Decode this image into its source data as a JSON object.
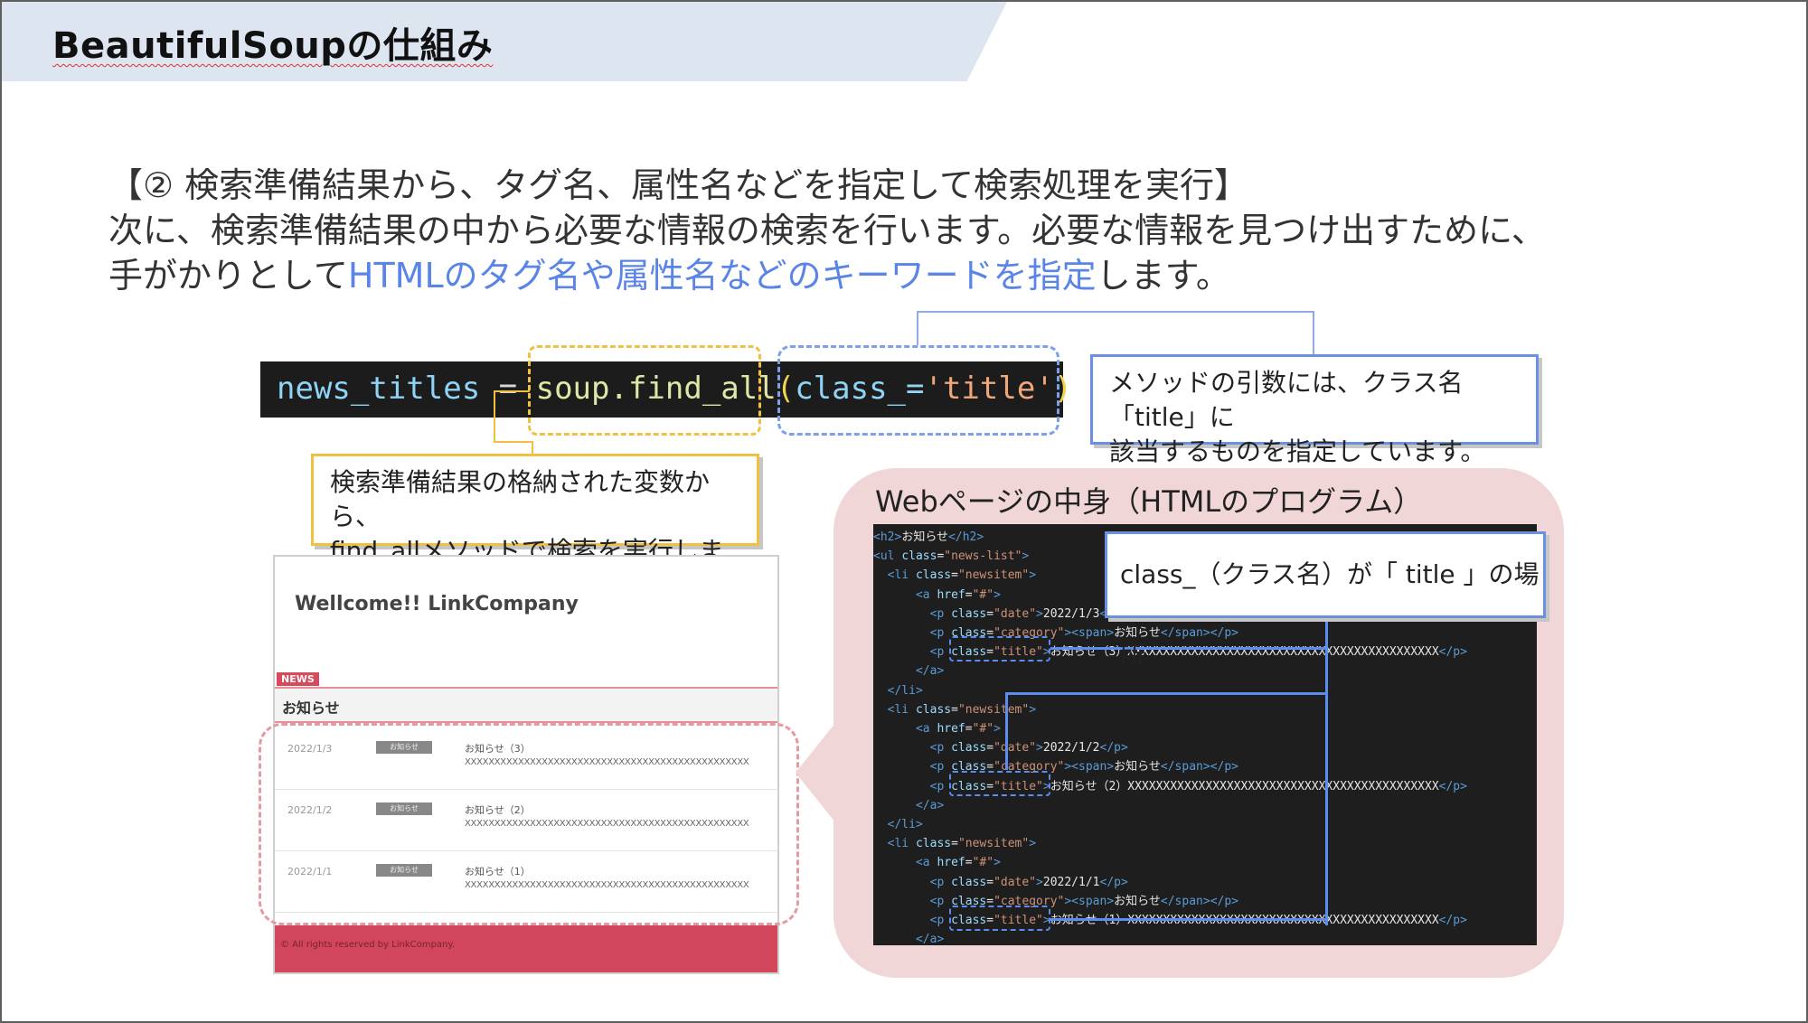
{
  "slide": {
    "title": "BeautifulSoupの仕組み",
    "intro": {
      "line1": "【② 検索準備結果から、タグ名、属性名などを指定して検索処理を実行】",
      "line2": "次に、検索準備結果の中から必要な情報の検索を行います。必要な情報を見つけ出すために、",
      "line3_pre": "手がかりとして",
      "line3_highlight": "HTMLのタグ名や属性名などのキーワードを指定",
      "line3_post": "します。"
    }
  },
  "code": {
    "var": "news_titles",
    "eq": " = ",
    "obj": "soup.find_all",
    "open": "(",
    "arg": "class_=",
    "str": "'title'",
    "close": ")"
  },
  "callouts": {
    "args_line1": "メソッドの引数には、クラス名「title」に",
    "args_line2": "該当するものを指定しています。",
    "findall_line1": "検索準備結果の格納された変数から、",
    "findall_word": "find_all",
    "findall_rest": "メソッドで検索を実行します。",
    "class_location": "class_（クラス名）が「 title 」の場所"
  },
  "webpage": {
    "title": "Wellcome!! LinkCompany",
    "news_badge": "NEWS",
    "news_label": "お知らせ",
    "items": [
      {
        "date": "2022/1/3",
        "category": "お知らせ",
        "title": "お知らせ（3）",
        "body": "XXXXXXXXXXXXXXXXXXXXXXXXXXXXXXXXXXXXXXXXXXXXXXXX"
      },
      {
        "date": "2022/1/2",
        "category": "お知らせ",
        "title": "お知らせ（2）",
        "body": "XXXXXXXXXXXXXXXXXXXXXXXXXXXXXXXXXXXXXXXXXXXXXXXX"
      },
      {
        "date": "2022/1/1",
        "category": "お知らせ",
        "title": "お知らせ（1）",
        "body": "XXXXXXXXXXXXXXXXXXXXXXXXXXXXXXXXXXXXXXXXXXXXXXXX"
      }
    ],
    "footer": "© All rights reserved by LinkCompany."
  },
  "panel": {
    "title": "Webページの中身（HTMLのプログラム）"
  },
  "html_source": [
    {
      "indent": "",
      "parts": [
        [
          "tag",
          "<h2>"
        ],
        [
          "txt",
          "お知らせ"
        ],
        [
          "tag",
          "</h2>"
        ]
      ]
    },
    {
      "indent": "",
      "parts": [
        [
          "tag",
          "<ul "
        ],
        [
          "attr",
          "class"
        ],
        [
          "txt",
          "="
        ],
        [
          "str",
          "\"news-list\""
        ],
        [
          "tag",
          ">"
        ]
      ]
    },
    {
      "indent": "  ",
      "parts": [
        [
          "tag",
          "<li "
        ],
        [
          "attr",
          "class"
        ],
        [
          "txt",
          "="
        ],
        [
          "str",
          "\"newsitem\""
        ],
        [
          "tag",
          ">"
        ]
      ]
    },
    {
      "indent": "      ",
      "parts": [
        [
          "tag",
          "<a "
        ],
        [
          "attr",
          "href"
        ],
        [
          "txt",
          "="
        ],
        [
          "str",
          "\"#\""
        ],
        [
          "tag",
          ">"
        ]
      ]
    },
    {
      "indent": "        ",
      "parts": [
        [
          "tag",
          "<p "
        ],
        [
          "attr",
          "class"
        ],
        [
          "txt",
          "="
        ],
        [
          "str",
          "\"date\""
        ],
        [
          "tag",
          ">"
        ],
        [
          "txt",
          "2022/1/3"
        ],
        [
          "tag",
          "</p>"
        ]
      ]
    },
    {
      "indent": "        ",
      "parts": [
        [
          "tag",
          "<p "
        ],
        [
          "attr",
          "class"
        ],
        [
          "txt",
          "="
        ],
        [
          "str",
          "\"category\""
        ],
        [
          "tag",
          "><span>"
        ],
        [
          "txt",
          "お知らせ"
        ],
        [
          "tag",
          "</span></p>"
        ]
      ]
    },
    {
      "indent": "        ",
      "parts": [
        [
          "tag",
          "<p "
        ],
        [
          "attr",
          "class"
        ],
        [
          "txt",
          "="
        ],
        [
          "str",
          "\"title\""
        ],
        [
          "tag",
          ">"
        ],
        [
          "txt",
          "お知らせ（3）XXXXXXXXXXXXXXXXXXXXXXXXXXXXXXXXXXXXXXXXXXXX"
        ],
        [
          "tag",
          "</p>"
        ]
      ]
    },
    {
      "indent": "      ",
      "parts": [
        [
          "tag",
          "</a>"
        ]
      ]
    },
    {
      "indent": "  ",
      "parts": [
        [
          "tag",
          "</li>"
        ]
      ]
    },
    {
      "indent": "  ",
      "parts": [
        [
          "tag",
          "<li "
        ],
        [
          "attr",
          "class"
        ],
        [
          "txt",
          "="
        ],
        [
          "str",
          "\"newsitem\""
        ],
        [
          "tag",
          ">"
        ]
      ]
    },
    {
      "indent": "      ",
      "parts": [
        [
          "tag",
          "<a "
        ],
        [
          "attr",
          "href"
        ],
        [
          "txt",
          "="
        ],
        [
          "str",
          "\"#\""
        ],
        [
          "tag",
          ">"
        ]
      ]
    },
    {
      "indent": "        ",
      "parts": [
        [
          "tag",
          "<p "
        ],
        [
          "attr",
          "class"
        ],
        [
          "txt",
          "="
        ],
        [
          "str",
          "\"date\""
        ],
        [
          "tag",
          ">"
        ],
        [
          "txt",
          "2022/1/2"
        ],
        [
          "tag",
          "</p>"
        ]
      ]
    },
    {
      "indent": "        ",
      "parts": [
        [
          "tag",
          "<p "
        ],
        [
          "attr",
          "class"
        ],
        [
          "txt",
          "="
        ],
        [
          "str",
          "\"category\""
        ],
        [
          "tag",
          "><span>"
        ],
        [
          "txt",
          "お知らせ"
        ],
        [
          "tag",
          "</span></p>"
        ]
      ]
    },
    {
      "indent": "        ",
      "parts": [
        [
          "tag",
          "<p "
        ],
        [
          "attr",
          "class"
        ],
        [
          "txt",
          "="
        ],
        [
          "str",
          "\"title\""
        ],
        [
          "tag",
          ">"
        ],
        [
          "txt",
          "お知らせ（2）XXXXXXXXXXXXXXXXXXXXXXXXXXXXXXXXXXXXXXXXXXXX"
        ],
        [
          "tag",
          "</p>"
        ]
      ]
    },
    {
      "indent": "      ",
      "parts": [
        [
          "tag",
          "</a>"
        ]
      ]
    },
    {
      "indent": "  ",
      "parts": [
        [
          "tag",
          "</li>"
        ]
      ]
    },
    {
      "indent": "  ",
      "parts": [
        [
          "tag",
          "<li "
        ],
        [
          "attr",
          "class"
        ],
        [
          "txt",
          "="
        ],
        [
          "str",
          "\"newsitem\""
        ],
        [
          "tag",
          ">"
        ]
      ]
    },
    {
      "indent": "      ",
      "parts": [
        [
          "tag",
          "<a "
        ],
        [
          "attr",
          "href"
        ],
        [
          "txt",
          "="
        ],
        [
          "str",
          "\"#\""
        ],
        [
          "tag",
          ">"
        ]
      ]
    },
    {
      "indent": "        ",
      "parts": [
        [
          "tag",
          "<p "
        ],
        [
          "attr",
          "class"
        ],
        [
          "txt",
          "="
        ],
        [
          "str",
          "\"date\""
        ],
        [
          "tag",
          ">"
        ],
        [
          "txt",
          "2022/1/1"
        ],
        [
          "tag",
          "</p>"
        ]
      ]
    },
    {
      "indent": "        ",
      "parts": [
        [
          "tag",
          "<p "
        ],
        [
          "attr",
          "class"
        ],
        [
          "txt",
          "="
        ],
        [
          "str",
          "\"category\""
        ],
        [
          "tag",
          "><span>"
        ],
        [
          "txt",
          "お知らせ"
        ],
        [
          "tag",
          "</span></p>"
        ]
      ]
    },
    {
      "indent": "        ",
      "parts": [
        [
          "tag",
          "<p "
        ],
        [
          "attr",
          "class"
        ],
        [
          "txt",
          "="
        ],
        [
          "str",
          "\"title\""
        ],
        [
          "tag",
          ">"
        ],
        [
          "txt",
          "お知らせ（1）XXXXXXXXXXXXXXXXXXXXXXXXXXXXXXXXXXXXXXXXXXXX"
        ],
        [
          "tag",
          "</p>"
        ]
      ]
    },
    {
      "indent": "      ",
      "parts": [
        [
          "tag",
          "</a>"
        ]
      ]
    }
  ],
  "colors": {
    "header_band": "#dde5f0",
    "highlight_text": "#5a85e6",
    "callout_blue": "#6b8fe3",
    "callout_yellow": "#f2c040",
    "panel_pink": "#f0d6d7",
    "footer_red": "#d2465b"
  }
}
